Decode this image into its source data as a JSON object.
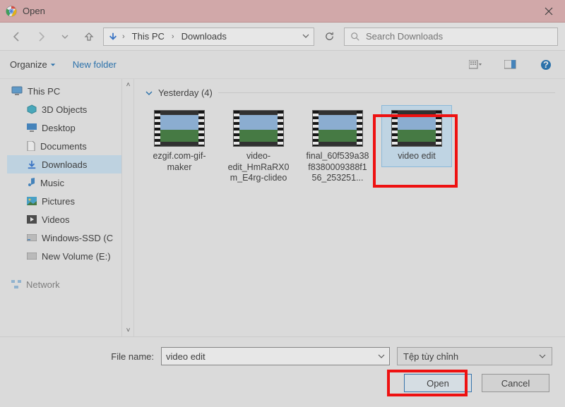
{
  "title": "Open",
  "breadcrumb": {
    "root": "This PC",
    "folder": "Downloads"
  },
  "search": {
    "placeholder": "Search Downloads"
  },
  "toolbar": {
    "organize": "Organize",
    "newfolder": "New folder"
  },
  "sidebar": {
    "root": "This PC",
    "items": [
      {
        "label": "3D Objects"
      },
      {
        "label": "Desktop"
      },
      {
        "label": "Documents"
      },
      {
        "label": "Downloads"
      },
      {
        "label": "Music"
      },
      {
        "label": "Pictures"
      },
      {
        "label": "Videos"
      },
      {
        "label": "Windows-SSD (C"
      },
      {
        "label": "New Volume (E:)"
      }
    ],
    "network": "Network"
  },
  "group": {
    "label": "Yesterday (4)"
  },
  "files": [
    {
      "name": "ezgif.com-gif-maker"
    },
    {
      "name": "video-edit_HmRaRX0m_E4rg-clideo"
    },
    {
      "name": "final_60f539a38f8380009388f156_253251..."
    },
    {
      "name": "video edit"
    }
  ],
  "footer": {
    "filename_label": "File name:",
    "filename_value": "video edit",
    "filetype": "Tệp tùy chỉnh",
    "open": "Open",
    "cancel": "Cancel"
  }
}
